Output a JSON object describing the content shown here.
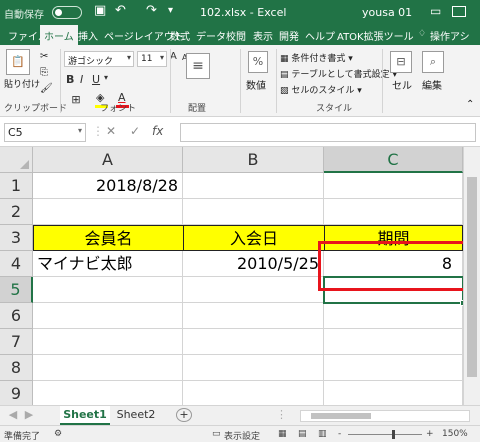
{
  "titlebar": {
    "autosave_label": "自動保存",
    "save_icon": "save-icon",
    "undo_icon": "undo-icon",
    "redo_icon": "redo-icon",
    "document_title": "102.xlsx  -  Excel",
    "user_name": "yousa 01"
  },
  "ribbon_tabs": [
    "ファイル",
    "ホーム",
    "挿入",
    "ページレイアウト",
    "数式",
    "データ",
    "校閲",
    "表示",
    "開発",
    "ヘルプ",
    "ATOK拡張ツール",
    "操作アシ"
  ],
  "ribbon": {
    "paste_label": "貼り付け",
    "clipboard_group": "クリップボード",
    "font_name": "游ゴシック",
    "font_size": "11",
    "bold": "B",
    "italic": "I",
    "underline": "U",
    "grow_font": "A",
    "shrink_font": "A",
    "font_color_letter": "A",
    "font_group": "フォント",
    "alignment_group": "配置",
    "number_label": "数値",
    "percent_symbol": "%",
    "conditional_format": "条件付き書式",
    "format_as_table": "テーブルとして書式設定",
    "cell_styles": "セルのスタイル",
    "styles_group": "スタイル",
    "cells_label": "セル",
    "editing_label": "編集",
    "accent_color": "#217346",
    "highlight_color": "#ffff00",
    "font_color": "#e8141c"
  },
  "formula_bar": {
    "name_box": "C5",
    "cancel": "✕",
    "enter": "✓",
    "fx": "fx",
    "content": ""
  },
  "sheet": {
    "columns": [
      "A",
      "B",
      "C"
    ],
    "rows": [
      "1",
      "2",
      "3",
      "4",
      "5",
      "6",
      "7",
      "8",
      "9"
    ],
    "cells": {
      "A1": "2018/8/28",
      "A3": "会員名",
      "B3": "入会日",
      "C3": "期間",
      "A4": "マイナビ太郎",
      "B4": "2010/5/25",
      "C4": "8"
    },
    "active_cell": "C5"
  },
  "sheet_tabs": [
    "Sheet1",
    "Sheet2"
  ],
  "add_sheet": "+",
  "statusbar": {
    "ready": "準備完了",
    "display_settings": "表示設定",
    "zoom_minus": "-",
    "zoom_plus": "+",
    "zoom": "150%"
  }
}
